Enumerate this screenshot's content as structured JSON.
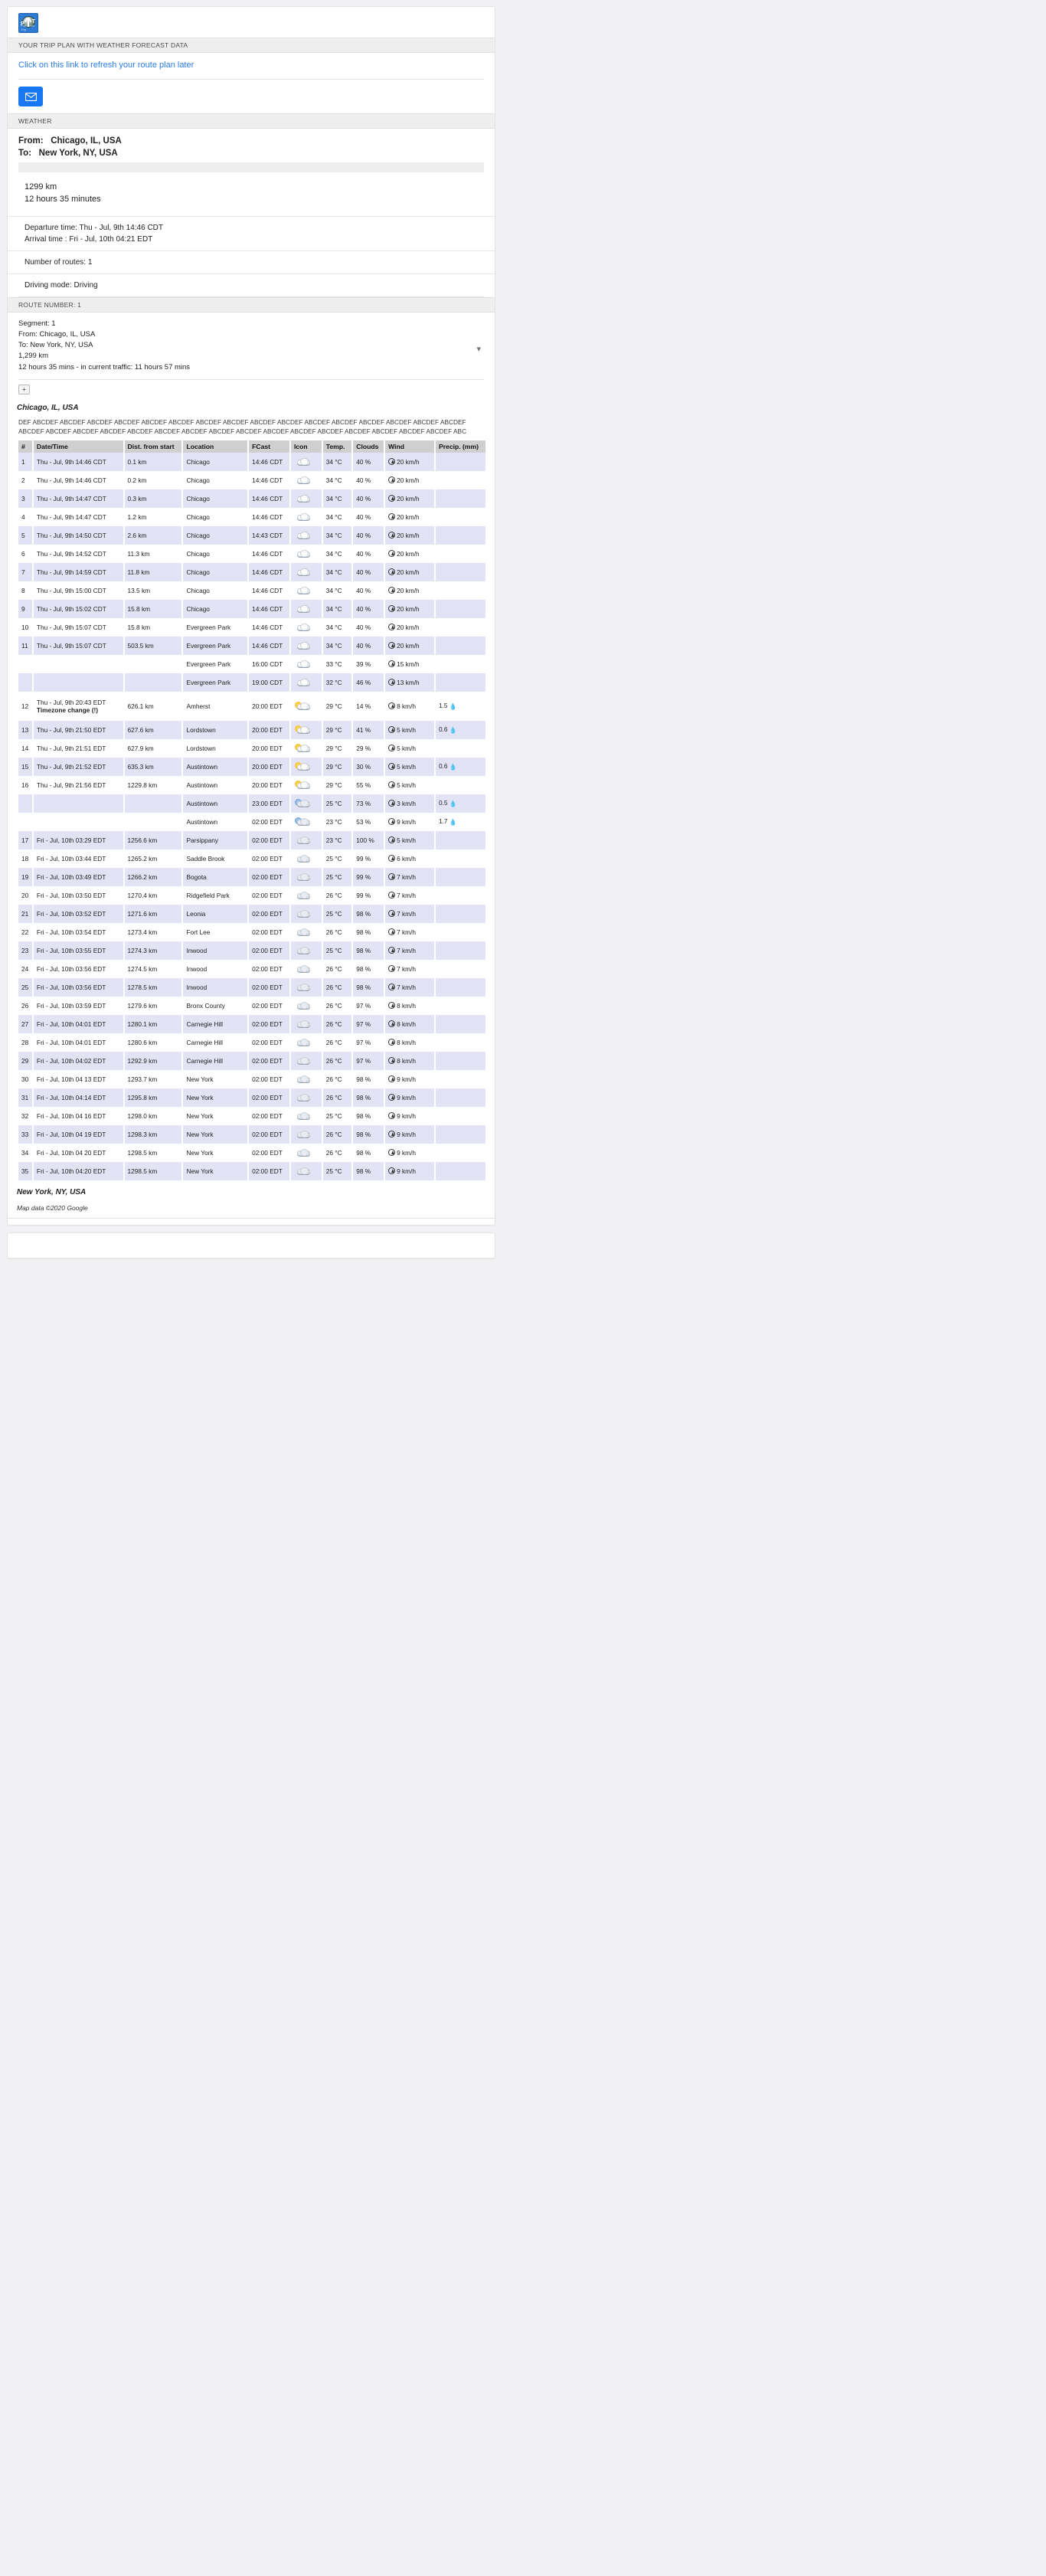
{
  "app": {
    "logo_alt": "Plan Your Trip logo",
    "logo_initials_p": "P",
    "logo_initials_t": "T",
    "logo_caption": "Plan Your Trip"
  },
  "header": {
    "section_label": "YOUR TRIP PLAN WITH WEATHER FORECAST DATA",
    "refresh_link": "Click on this link to refresh your route plan later"
  },
  "weather_section": {
    "label": "WEATHER",
    "from_label": "From:",
    "from_value": "Chicago, IL, USA",
    "to_label": "To:",
    "to_value": "New York, NY, USA"
  },
  "summary": {
    "distance": "1299 km",
    "duration": "12 hours 35 minutes",
    "departure_time": "Departure time: Thu - Jul, 9th 14:46 CDT",
    "arrival_time": "Arrival time : Fri - Jul, 10th 04:21 EDT",
    "number_of_routes": "Number of routes:  1",
    "driving_mode": "Driving mode:  Driving"
  },
  "route": {
    "label": "ROUTE NUMBER: 1",
    "segment": "Segment: 1",
    "from": "From: Chicago, IL, USA",
    "to": "To: New York, NY, USA",
    "distance": "1,299 km",
    "duration": "12 hours 35 mins - in current traffic: 11 hours 57 mins",
    "expand_icon": "chevron-down-icon"
  },
  "toolbar": {
    "expand_button": "+"
  },
  "origin_city": "Chicago, IL, USA",
  "filler_text": "DEF ABCDEF ABCDEF ABCDEF ABCDEF ABCDEF ABCDEF ABCDEF ABCDEF ABCDEF ABCDEF ABCDEF ABCDEF ABCDEF ABCDEF ABCDEF ABCDEF ABCDEF ABCDEF ABCDEF ABCDEF ABCDEF ABCDEF ABCDEF ABCDEF ABCDEF ABCDEF ABCDEF ABCDEF ABCDEF ABCDEF ABCDEF ABCDEF ABC",
  "destination_city": "New York, NY, USA",
  "map_attribution": "Map data ©2020 Google",
  "table": {
    "columns": [
      "#",
      "Date/Time",
      "Dist. from start",
      "Location",
      "FCast",
      "Icon",
      "Temp.",
      "Clouds",
      "Wind",
      "Precip. (mm)"
    ],
    "rows": [
      {
        "n": "1",
        "dt": "Thu - Jul, 9th 14:46 CDT",
        "dist": "0.1 km",
        "loc": "Chicago",
        "fc": "14:46 CDT",
        "icon": "cloud",
        "temp": "34 °C",
        "clouds": "40 %",
        "wind": "20 km/h",
        "precip": ""
      },
      {
        "n": "2",
        "dt": "Thu - Jul, 9th 14:46 CDT",
        "dist": "0.2 km",
        "loc": "Chicago",
        "fc": "14:46 CDT",
        "icon": "cloud",
        "temp": "34 °C",
        "clouds": "40 %",
        "wind": "20 km/h",
        "precip": ""
      },
      {
        "n": "3",
        "dt": "Thu - Jul, 9th 14:47 CDT",
        "dist": "0.3 km",
        "loc": "Chicago",
        "fc": "14:46 CDT",
        "icon": "cloud",
        "temp": "34 °C",
        "clouds": "40 %",
        "wind": "20 km/h",
        "precip": ""
      },
      {
        "n": "4",
        "dt": "Thu - Jul, 9th 14:47 CDT",
        "dist": "1.2 km",
        "loc": "Chicago",
        "fc": "14:46 CDT",
        "icon": "cloud",
        "temp": "34 °C",
        "clouds": "40 %",
        "wind": "20 km/h",
        "precip": ""
      },
      {
        "n": "5",
        "dt": "Thu - Jul, 9th 14:50 CDT",
        "dist": "2.6 km",
        "loc": "Chicago",
        "fc": "14:43 CDT",
        "icon": "cloud",
        "temp": "34 °C",
        "clouds": "40 %",
        "wind": "20 km/h",
        "precip": ""
      },
      {
        "n": "6",
        "dt": "Thu - Jul, 9th 14:52 CDT",
        "dist": "11.3 km",
        "loc": "Chicago",
        "fc": "14:46 CDT",
        "icon": "cloud",
        "temp": "34 °C",
        "clouds": "40 %",
        "wind": "20 km/h",
        "precip": ""
      },
      {
        "n": "7",
        "dt": "Thu - Jul, 9th 14:59 CDT",
        "dist": "11.8 km",
        "loc": "Chicago",
        "fc": "14:46 CDT",
        "icon": "cloud",
        "temp": "34 °C",
        "clouds": "40 %",
        "wind": "20 km/h",
        "precip": ""
      },
      {
        "n": "8",
        "dt": "Thu - Jul, 9th 15:00 CDT",
        "dist": "13.5 km",
        "loc": "Chicago",
        "fc": "14:46 CDT",
        "icon": "cloud",
        "temp": "34 °C",
        "clouds": "40 %",
        "wind": "20 km/h",
        "precip": ""
      },
      {
        "n": "9",
        "dt": "Thu - Jul, 9th 15:02 CDT",
        "dist": "15.8 km",
        "loc": "Chicago",
        "fc": "14:46 CDT",
        "icon": "cloud",
        "temp": "34 °C",
        "clouds": "40 %",
        "wind": "20 km/h",
        "precip": ""
      },
      {
        "n": "10",
        "dt": "Thu - Jul, 9th 15:07 CDT",
        "dist": "15.8 km",
        "loc": "Evergreen Park",
        "fc": "14:46 CDT",
        "icon": "cloud",
        "temp": "34 °C",
        "clouds": "40 %",
        "wind": "20 km/h",
        "precip": ""
      },
      {
        "n": "11",
        "dt": "Thu - Jul, 9th 15:07 CDT",
        "dist": "503.5 km",
        "loc": "Evergreen Park",
        "fc": "14:46 CDT",
        "icon": "cloud",
        "temp": "34 °C",
        "clouds": "40 %",
        "wind": "20 km/h",
        "precip": ""
      },
      {
        "n": "",
        "dt": "",
        "dist": "",
        "loc": "Evergreen Park",
        "fc": "16:00 CDT",
        "icon": "cloud",
        "temp": "33 °C",
        "clouds": "39 %",
        "wind": "15 km/h",
        "precip": ""
      },
      {
        "n": "",
        "dt": "",
        "dist": "",
        "loc": "Evergreen Park",
        "fc": "19:00 CDT",
        "icon": "cloud",
        "temp": "32 °C",
        "clouds": "46 %",
        "wind": "13 km/h",
        "precip": ""
      },
      {
        "n": "12",
        "dt": "Thu - Jul, 9th 20:43 EDT",
        "dist": "626.1 km",
        "loc": "Amherst",
        "fc": "20:00 EDT",
        "icon": "sun-cloud",
        "temp": "29 °C",
        "clouds": "14 %",
        "wind": "8 km/h",
        "precip": "1.5",
        "tz_note": "Timezone change (!)"
      },
      {
        "n": "13",
        "dt": "Thu - Jul, 9th 21:50 EDT",
        "dist": "627.6 km",
        "loc": "Lordstown",
        "fc": "20:00 EDT",
        "icon": "sun-cloud",
        "temp": "29 °C",
        "clouds": "41 %",
        "wind": "5 km/h",
        "precip": "0.6"
      },
      {
        "n": "14",
        "dt": "Thu - Jul, 9th 21:51 EDT",
        "dist": "627.9 km",
        "loc": "Lordstown",
        "fc": "20:00 EDT",
        "icon": "sun-cloud",
        "temp": "29 °C",
        "clouds": "29 %",
        "wind": "5 km/h",
        "precip": ""
      },
      {
        "n": "15",
        "dt": "Thu - Jul, 9th 21:52 EDT",
        "dist": "635.3 km",
        "loc": "Austintown",
        "fc": "20:00 EDT",
        "icon": "sun-cloud",
        "temp": "29 °C",
        "clouds": "30 %",
        "wind": "5 km/h",
        "precip": "0.6"
      },
      {
        "n": "16",
        "dt": "Thu - Jul, 9th 21:56 EDT",
        "dist": "1229.8 km",
        "loc": "Austintown",
        "fc": "20:00 EDT",
        "icon": "sun-cloud",
        "temp": "29 °C",
        "clouds": "55 %",
        "wind": "5 km/h",
        "precip": ""
      },
      {
        "n": "",
        "dt": "",
        "dist": "",
        "loc": "Austintown",
        "fc": "23:00 EDT",
        "icon": "moon-cloud",
        "temp": "25 °C",
        "clouds": "73 %",
        "wind": "3 km/h",
        "precip": "0.5"
      },
      {
        "n": "",
        "dt": "",
        "dist": "",
        "loc": "Austintown",
        "fc": "02:00 EDT",
        "icon": "moon-cloud",
        "temp": "23 °C",
        "clouds": "53 %",
        "wind": "9 km/h",
        "precip": "1.7"
      },
      {
        "n": "17",
        "dt": "Fri - Jul, 10th 03:29 EDT",
        "dist": "1256.6 km",
        "loc": "Parsippany",
        "fc": "02:00 EDT",
        "icon": "dark-cloud",
        "temp": "23 °C",
        "clouds": "100 %",
        "wind": "5 km/h",
        "precip": ""
      },
      {
        "n": "18",
        "dt": "Fri - Jul, 10th 03:44 EDT",
        "dist": "1265.2 km",
        "loc": "Saddle Brook",
        "fc": "02:00 EDT",
        "icon": "dark-cloud",
        "temp": "25 °C",
        "clouds": "99 %",
        "wind": "6 km/h",
        "precip": ""
      },
      {
        "n": "19",
        "dt": "Fri - Jul, 10th 03:49 EDT",
        "dist": "1266.2 km",
        "loc": "Bogota",
        "fc": "02:00 EDT",
        "icon": "dark-cloud",
        "temp": "25 °C",
        "clouds": "99 %",
        "wind": "7 km/h",
        "precip": ""
      },
      {
        "n": "20",
        "dt": "Fri - Jul, 10th 03:50 EDT",
        "dist": "1270.4 km",
        "loc": "Ridgefield Park",
        "fc": "02:00 EDT",
        "icon": "dark-cloud",
        "temp": "26 °C",
        "clouds": "99 %",
        "wind": "7 km/h",
        "precip": ""
      },
      {
        "n": "21",
        "dt": "Fri - Jul, 10th 03:52 EDT",
        "dist": "1271.6 km",
        "loc": "Leonia",
        "fc": "02:00 EDT",
        "icon": "dark-cloud",
        "temp": "25 °C",
        "clouds": "98 %",
        "wind": "7 km/h",
        "precip": ""
      },
      {
        "n": "22",
        "dt": "Fri - Jul, 10th 03:54 EDT",
        "dist": "1273.4 km",
        "loc": "Fort Lee",
        "fc": "02:00 EDT",
        "icon": "dark-cloud",
        "temp": "26 °C",
        "clouds": "98 %",
        "wind": "7 km/h",
        "precip": ""
      },
      {
        "n": "23",
        "dt": "Fri - Jul, 10th 03:55 EDT",
        "dist": "1274.3 km",
        "loc": "Inwood",
        "fc": "02:00 EDT",
        "icon": "dark-cloud",
        "temp": "25 °C",
        "clouds": "98 %",
        "wind": "7 km/h",
        "precip": ""
      },
      {
        "n": "24",
        "dt": "Fri - Jul, 10th 03:56 EDT",
        "dist": "1274.5 km",
        "loc": "Inwood",
        "fc": "02:00 EDT",
        "icon": "dark-cloud",
        "temp": "26 °C",
        "clouds": "98 %",
        "wind": "7 km/h",
        "precip": ""
      },
      {
        "n": "25",
        "dt": "Fri - Jul, 10th 03:56 EDT",
        "dist": "1278.5 km",
        "loc": "Inwood",
        "fc": "02:00 EDT",
        "icon": "dark-cloud",
        "temp": "26 °C",
        "clouds": "98 %",
        "wind": "7 km/h",
        "precip": ""
      },
      {
        "n": "26",
        "dt": "Fri - Jul, 10th 03:59 EDT",
        "dist": "1279.6 km",
        "loc": "Bronx County",
        "fc": "02:00 EDT",
        "icon": "dark-cloud",
        "temp": "26 °C",
        "clouds": "97 %",
        "wind": "8 km/h",
        "precip": ""
      },
      {
        "n": "27",
        "dt": "Fri - Jul, 10th 04:01 EDT",
        "dist": "1280.1 km",
        "loc": "Carnegie Hill",
        "fc": "02:00 EDT",
        "icon": "dark-cloud",
        "temp": "26 °C",
        "clouds": "97 %",
        "wind": "8 km/h",
        "precip": ""
      },
      {
        "n": "28",
        "dt": "Fri - Jul, 10th 04:01 EDT",
        "dist": "1280.6 km",
        "loc": "Carnegie Hill",
        "fc": "02:00 EDT",
        "icon": "dark-cloud",
        "temp": "26 °C",
        "clouds": "97 %",
        "wind": "8 km/h",
        "precip": ""
      },
      {
        "n": "29",
        "dt": "Fri - Jul, 10th 04:02 EDT",
        "dist": "1292.9 km",
        "loc": "Carnegie Hill",
        "fc": "02:00 EDT",
        "icon": "dark-cloud",
        "temp": "26 °C",
        "clouds": "97 %",
        "wind": "8 km/h",
        "precip": ""
      },
      {
        "n": "30",
        "dt": "Fri - Jul, 10th 04 13 EDT",
        "dist": "1293.7 km",
        "loc": "New York",
        "fc": "02:00 EDT",
        "icon": "dark-cloud",
        "temp": "26 °C",
        "clouds": "98 %",
        "wind": "9 km/h",
        "precip": ""
      },
      {
        "n": "31",
        "dt": "Fri - Jul, 10th 04:14 EDT",
        "dist": "1295.8 km",
        "loc": "New York",
        "fc": "02:00 EDT",
        "icon": "dark-cloud",
        "temp": "26 °C",
        "clouds": "98 %",
        "wind": "9 km/h",
        "precip": ""
      },
      {
        "n": "32",
        "dt": "Fri - Jul, 10th 04 16 EDT",
        "dist": "1298.0 km",
        "loc": "New York",
        "fc": "02:00 EDT",
        "icon": "dark-cloud",
        "temp": "25 °C",
        "clouds": "98 %",
        "wind": "9 km/h",
        "precip": ""
      },
      {
        "n": "33",
        "dt": "Fri - Jul, 10th 04 19 EDT",
        "dist": "1298.3 km",
        "loc": "New York",
        "fc": "02:00 EDT",
        "icon": "dark-cloud",
        "temp": "26 °C",
        "clouds": "98 %",
        "wind": "9 km/h",
        "precip": ""
      },
      {
        "n": "34",
        "dt": "Fri - Jul, 10th 04 20 EDT",
        "dist": "1298.5 km",
        "loc": "New York",
        "fc": "02:00 EDT",
        "icon": "dark-cloud",
        "temp": "26 °C",
        "clouds": "98 %",
        "wind": "9 km/h",
        "precip": ""
      },
      {
        "n": "35",
        "dt": "Fri - Jul, 10th 04:20 EDT",
        "dist": "1298.5 km",
        "loc": "New York",
        "fc": "02:00 EDT",
        "icon": "dark-cloud",
        "temp": "25 °C",
        "clouds": "98 %",
        "wind": "9 km/h",
        "precip": ""
      }
    ]
  },
  "colors": {
    "accent": "#1877f2",
    "link": "#2b7de9",
    "row_odd": "#e2e3f5",
    "header_bg": "#cfcfcf"
  }
}
